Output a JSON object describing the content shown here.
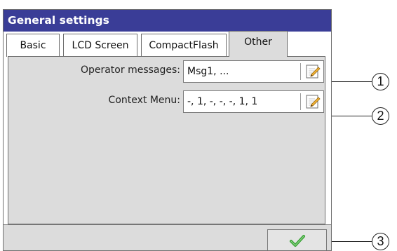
{
  "window": {
    "title": "General settings"
  },
  "tabs": [
    {
      "label": "Basic",
      "active": false
    },
    {
      "label": "LCD Screen",
      "active": false
    },
    {
      "label": "CompactFlash",
      "active": false
    },
    {
      "label": "Other",
      "active": true
    }
  ],
  "fields": {
    "operator_messages": {
      "label": "Operator messages:",
      "value": "Msg1, ..."
    },
    "context_menu": {
      "label": "Context Menu:",
      "value": "-, 1, -, -, -, 1, 1"
    }
  },
  "callouts": [
    "1",
    "2",
    "3"
  ],
  "icons": {
    "edit": "edit-notepad-icon",
    "confirm": "checkmark-icon"
  },
  "colors": {
    "title_bar": "#3a3d97",
    "panel": "#dcdcdc",
    "checkmark": "#3aa336"
  }
}
